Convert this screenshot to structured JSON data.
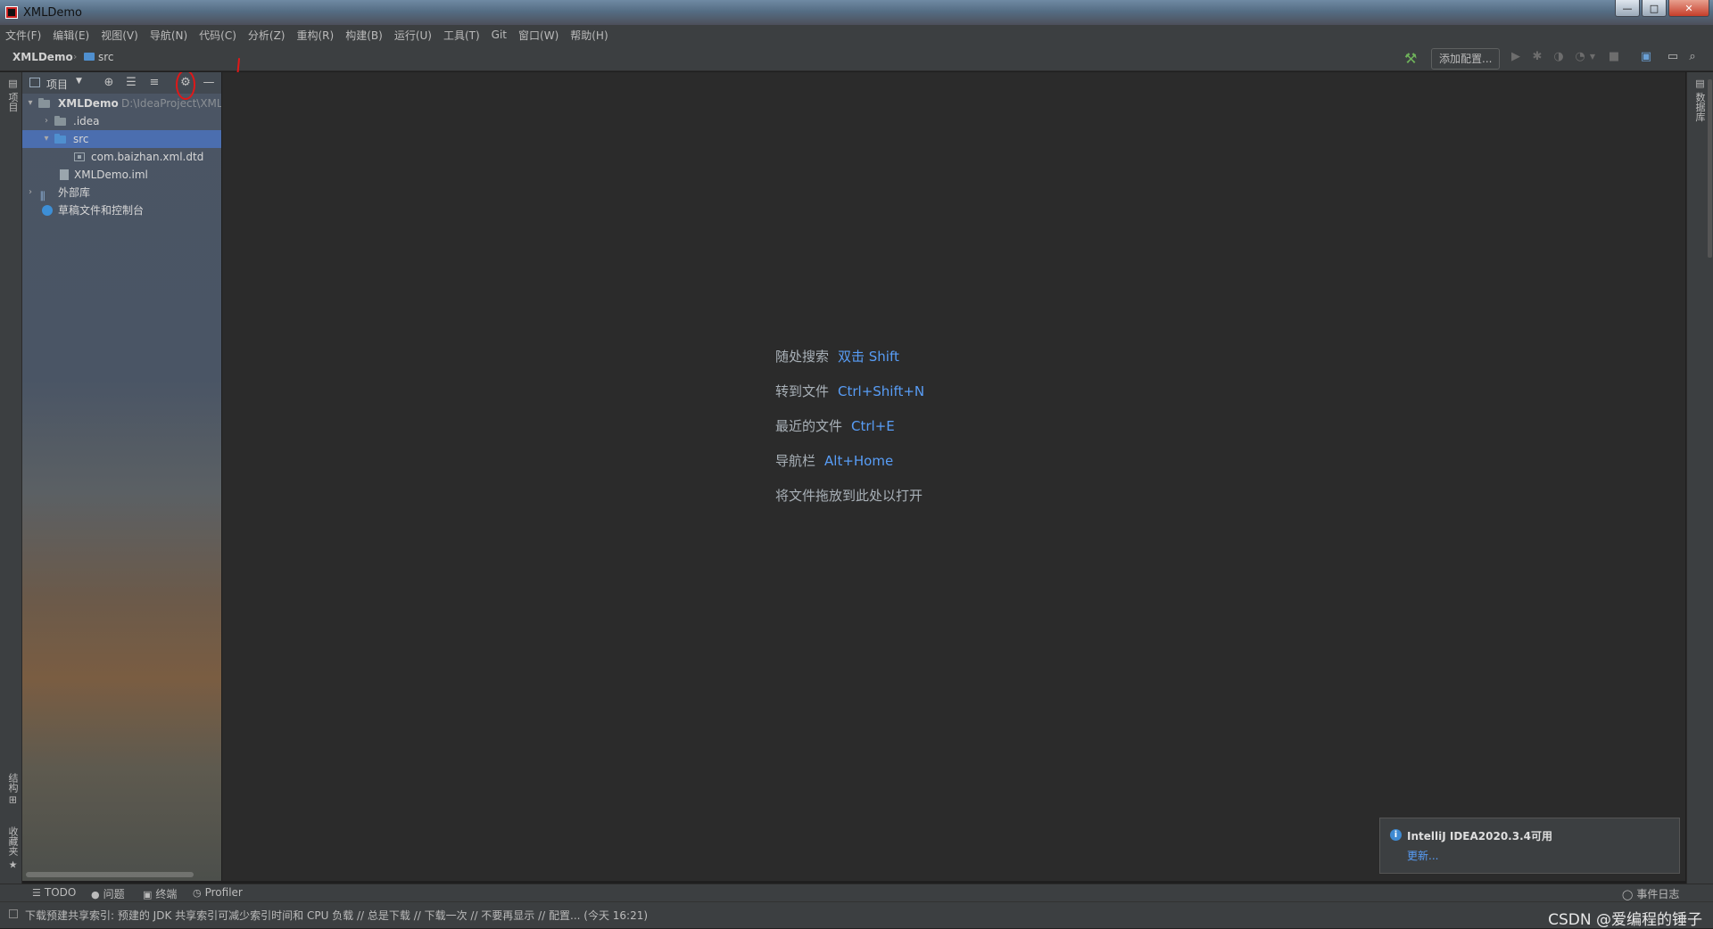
{
  "window": {
    "title": "XMLDemo",
    "minimize": "—",
    "maximize": "□",
    "close": "✕"
  },
  "menu": [
    "文件(F)",
    "编辑(E)",
    "视图(V)",
    "导航(N)",
    "代码(C)",
    "分析(Z)",
    "重构(R)",
    "构建(B)",
    "运行(U)",
    "工具(T)",
    "Git",
    "窗口(W)",
    "帮助(H)"
  ],
  "navbar": {
    "project": "XMLDemo",
    "separator": "›",
    "folder": "src",
    "add_config": "添加配置..."
  },
  "left_strip": {
    "project_tab": "项目",
    "structure_tab": "结构",
    "favorites_tab": "收藏夹"
  },
  "project_panel": {
    "view_label": "项目",
    "tree": {
      "root_name": "XMLDemo",
      "root_path": "D:\\IdeaProject\\XMLDemo",
      "idea": ".idea",
      "src": "src",
      "dtd": "com.baizhan.xml.dtd",
      "iml": "XMLDemo.iml",
      "libs": "外部库",
      "scratches": "草稿文件和控制台"
    }
  },
  "editor": {
    "hints": [
      {
        "label": "随处搜索",
        "key": "双击 Shift"
      },
      {
        "label": "转到文件",
        "key": "Ctrl+Shift+N"
      },
      {
        "label": "最近的文件",
        "key": "Ctrl+E"
      },
      {
        "label": "导航栏",
        "key": "Alt+Home"
      }
    ],
    "drop_hint": "将文件拖放到此处以打开"
  },
  "notification": {
    "title": "IntelliJ IDEA2020.3.4可用",
    "link": "更新..."
  },
  "right_strip": {
    "database": "数据库"
  },
  "bottom_tabs": {
    "todo": "TODO",
    "problems": "问题",
    "terminal": "终端",
    "profiler": "Profiler",
    "event_log": "事件日志"
  },
  "status": {
    "text": "下载预建共享索引: 预建的 JDK 共享索引可减少索引时间和 CPU 负载 // 总是下载 // 下载一次 // 不要再显示 // 配置... (今天 16:21)",
    "watermark": "CSDN @爱编程的锤子"
  },
  "annotation": {
    "mark": "1."
  },
  "colors": {
    "accent": "#589df6",
    "selection": "#4b6eaf",
    "annotation": "#e01818",
    "editor_bg": "#2b2b2b",
    "chrome_bg": "#3c3f41"
  }
}
